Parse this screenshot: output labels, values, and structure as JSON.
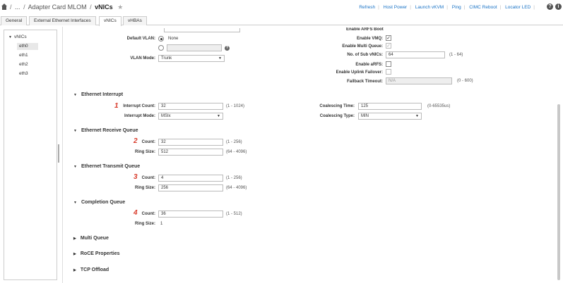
{
  "header": {
    "breadcrumb": [
      "...",
      "Adapter Card MLOM",
      "vNICs"
    ],
    "links": [
      "Refresh",
      "Host Power",
      "Launch vKVM",
      "Ping",
      "CIMC Reboot",
      "Locator LED"
    ],
    "help_glyph": "?",
    "info_glyph": "i"
  },
  "tabs": [
    {
      "label": "General"
    },
    {
      "label": "External Ethernet Interfaces"
    },
    {
      "label": "vNICs"
    },
    {
      "label": "vHBAs"
    }
  ],
  "tree": {
    "root": "vNICs",
    "items": [
      "eth0",
      "eth1",
      "eth2",
      "eth3"
    ]
  },
  "vlan": {
    "default_vlan_label": "Default VLAN:",
    "none_label": "None",
    "vlan_mode_label": "VLAN Mode:",
    "vlan_mode_value": "Trunk"
  },
  "right_settings": {
    "enable_vmq_label": "Enable VMQ:",
    "enable_multi_queue_label": "Enable Multi Queue:",
    "sub_vnics_label": "No. of Sub vNICs:",
    "sub_vnics_value": "64",
    "sub_vnics_range": "(1 - 64)",
    "enable_arfs_label": "Enable aRFS:",
    "enable_uplink_label": "Enable Uplink Failover:",
    "failback_label": "Failback Timeout:",
    "failback_value": "N/A",
    "failback_range": "(0 - 600)"
  },
  "ethernet_interrupt": {
    "title": "Ethernet Interrupt",
    "marker": "1",
    "count_label": "Interrupt Count:",
    "count_value": "32",
    "count_range": "(1 - 1024)",
    "mode_label": "Interrupt Mode:",
    "mode_value": "MSIx",
    "coalescing_time_label": "Coalescing Time:",
    "coalescing_time_value": "125",
    "coalescing_time_range": "(0-65535us)",
    "coalescing_type_label": "Coalescing Type:",
    "coalescing_type_value": "MIN"
  },
  "receive_queue": {
    "title": "Ethernet Receive Queue",
    "marker": "2",
    "count_label": "Count:",
    "count_value": "32",
    "count_range": "(1 - 256)",
    "ring_label": "Ring Size:",
    "ring_value": "512",
    "ring_range": "(64 - 4096)"
  },
  "transmit_queue": {
    "title": "Ethernet Transmit Queue",
    "marker": "3",
    "count_label": "Count:",
    "count_value": "4",
    "count_range": "(1 - 256)",
    "ring_label": "Ring Size:",
    "ring_value": "256",
    "ring_range": "(64 - 4096)"
  },
  "completion_queue": {
    "title": "Completion Queue",
    "marker": "4",
    "count_label": "Count:",
    "count_value": "36",
    "count_range": "(1 - 512)",
    "ring_label": "Ring Size:",
    "ring_value": "1"
  },
  "collapsed_sections": [
    "Multi Queue",
    "RoCE Properties",
    "TCP Offload"
  ],
  "colors": {
    "link": "#1a73c6",
    "marker": "#d83a2a"
  }
}
